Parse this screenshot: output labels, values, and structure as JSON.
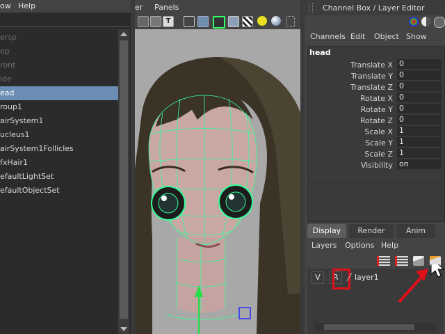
{
  "outliner": {
    "menu": [
      "ow",
      "Help"
    ],
    "items": [
      {
        "label": "ersp",
        "state": "dim"
      },
      {
        "label": "op",
        "state": "dim"
      },
      {
        "label": "ront",
        "state": "dim"
      },
      {
        "label": "ide",
        "state": "dim"
      },
      {
        "label": "ead",
        "state": "selected"
      },
      {
        "label": "roup1",
        "state": "normal"
      },
      {
        "label": "airSystem1",
        "state": "normal"
      },
      {
        "label": "ucleus1",
        "state": "normal"
      },
      {
        "label": "airSystem1Follicles",
        "state": "normal"
      },
      {
        "label": "fxHair1",
        "state": "normal"
      },
      {
        "label": "efaultLightSet",
        "state": "normal"
      },
      {
        "label": "efaultObjectSet",
        "state": "normal"
      }
    ]
  },
  "viewport": {
    "menu": [
      "er",
      "Panels"
    ],
    "toolbar_icons": [
      "wireframe-icon",
      "smooth-shade-icon",
      "textured-icon",
      "cube-wire-icon",
      "cube-shaded-icon",
      "cube-select-icon",
      "cube-texture-icon",
      "checker-icon",
      "light-icon",
      "sphere-icon",
      "grid-icon"
    ]
  },
  "channel_box": {
    "title": "Channel Box / Layer Editor",
    "menu": [
      "Channels",
      "Edit",
      "Object",
      "Show"
    ],
    "object_name": "head",
    "attributes": [
      {
        "label": "Translate X",
        "value": "0"
      },
      {
        "label": "Translate Y",
        "value": "0"
      },
      {
        "label": "Translate Z",
        "value": "0"
      },
      {
        "label": "Rotate X",
        "value": "0"
      },
      {
        "label": "Rotate Y",
        "value": "0"
      },
      {
        "label": "Rotate Z",
        "value": "0"
      },
      {
        "label": "Scale X",
        "value": "1"
      },
      {
        "label": "Scale Y",
        "value": "1"
      },
      {
        "label": "Scale Z",
        "value": "1"
      },
      {
        "label": "Visibility",
        "value": "on"
      }
    ]
  },
  "layer_editor": {
    "tabs": [
      {
        "label": "Display",
        "active": true
      },
      {
        "label": "Render",
        "active": false
      },
      {
        "label": "Anim",
        "active": false
      }
    ],
    "menu": [
      "Layers",
      "Options",
      "Help"
    ],
    "layer": {
      "visible_toggle": "V",
      "ref_toggle": "R",
      "name": "layer1"
    }
  },
  "colors": {
    "selection": "#6b8db4",
    "wireframe": "#33ff99",
    "annotation": "#e0101a"
  }
}
